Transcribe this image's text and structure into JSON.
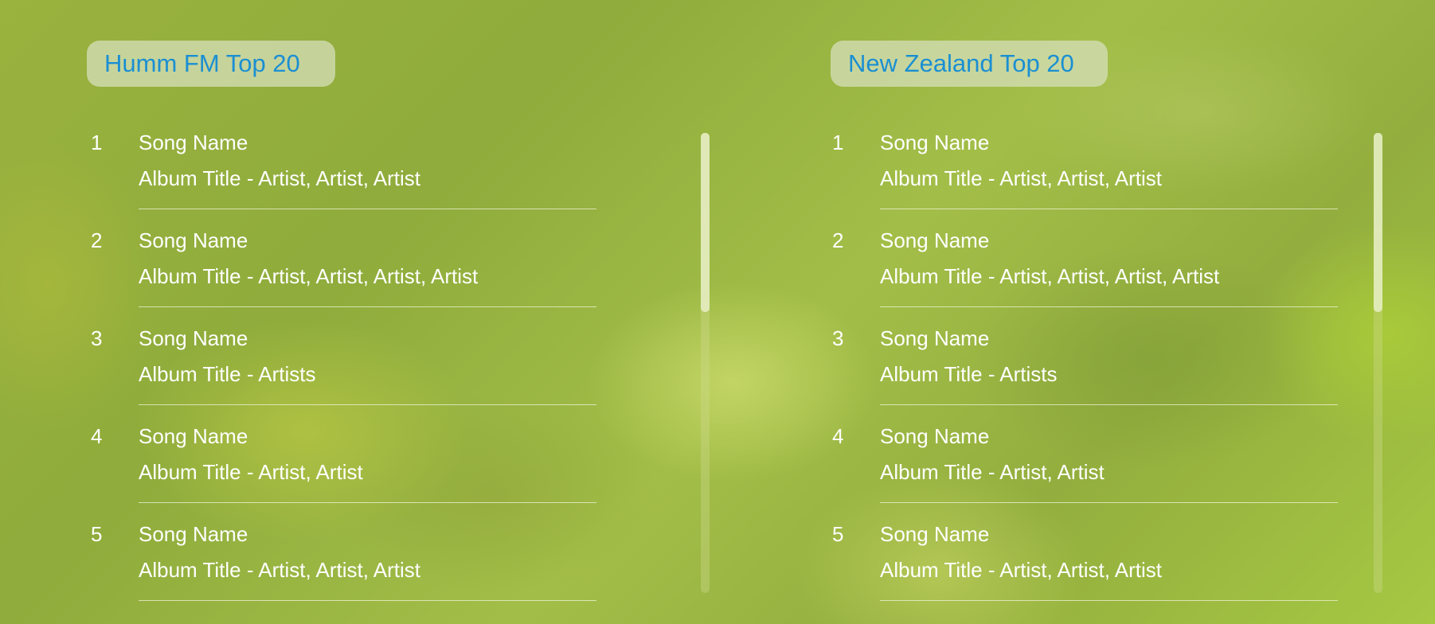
{
  "panels": [
    {
      "title": "Humm FM Top 20",
      "songs": [
        {
          "rank": "1",
          "song": "Song Name",
          "album": "Album Title - Artist, Artist, Artist"
        },
        {
          "rank": "2",
          "song": "Song Name",
          "album": "Album Title - Artist, Artist, Artist, Artist"
        },
        {
          "rank": "3",
          "song": "Song Name",
          "album": "Album Title - Artists"
        },
        {
          "rank": "4",
          "song": "Song Name",
          "album": "Album Title - Artist, Artist"
        },
        {
          "rank": "5",
          "song": "Song Name",
          "album": "Album Title - Artist, Artist, Artist"
        }
      ]
    },
    {
      "title": "New Zealand Top 20",
      "songs": [
        {
          "rank": "1",
          "song": "Song Name",
          "album": "Album Title - Artist, Artist, Artist"
        },
        {
          "rank": "2",
          "song": "Song Name",
          "album": "Album Title - Artist, Artist, Artist, Artist"
        },
        {
          "rank": "3",
          "song": "Song Name",
          "album": "Album Title - Artists"
        },
        {
          "rank": "4",
          "song": "Song Name",
          "album": "Album Title - Artist, Artist"
        },
        {
          "rank": "5",
          "song": "Song Name",
          "album": "Album Title - Artist, Artist, Artist"
        }
      ]
    }
  ],
  "colors": {
    "title_text": "#1b8fd2",
    "song_text": "#ffffff",
    "background": "#9ab23e"
  }
}
